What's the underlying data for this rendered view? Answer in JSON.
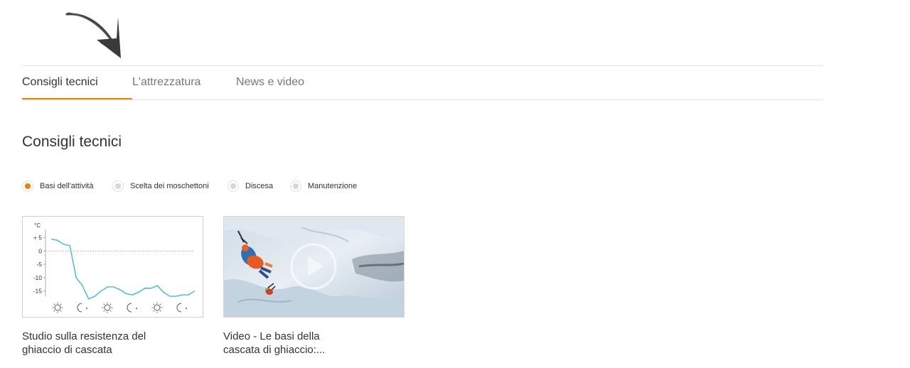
{
  "tabs": [
    {
      "label": "Consigli tecnici",
      "active": true
    },
    {
      "label": "L'attrezzatura",
      "active": false
    },
    {
      "label": "News e video",
      "active": false
    }
  ],
  "section": {
    "title": "Consigli tecnici"
  },
  "filters": [
    {
      "label": "Basi dell'attività",
      "selected": true
    },
    {
      "label": "Scelta dei moschettoni",
      "selected": false
    },
    {
      "label": "Discesa",
      "selected": false
    },
    {
      "label": "Manutenzione",
      "selected": false
    }
  ],
  "cards": [
    {
      "title_line1": "Studio sulla resistenza del",
      "title_line2": "ghiaccio di cascata",
      "thumb": "temperature-chart"
    },
    {
      "title_line1": "Video - Le basi della",
      "title_line2": "cascata di ghiaccio:...",
      "thumb": "ice-climbing-video"
    }
  ],
  "chart_data": {
    "type": "line",
    "title": "",
    "ylabel": "°C",
    "xlabel": "",
    "ylim": [
      -17,
      7
    ],
    "ytick_labels": [
      "+ 5",
      "0",
      "-5",
      "-10",
      "-15"
    ],
    "yticks": [
      5,
      0,
      -5,
      -10,
      -15
    ],
    "x_icons": [
      "sun-icon",
      "moon-icon",
      "sun-icon",
      "moon-icon",
      "sun-icon",
      "moon-icon"
    ],
    "series": [
      {
        "color": "#29b6e8",
        "values": [
          4.5,
          4,
          2.5,
          2,
          -10,
          -13,
          -18,
          -17,
          -15,
          -13.5,
          -13.5,
          -14.5,
          -16,
          -16.5,
          -15.5,
          -14,
          -14,
          -13,
          -15.5,
          -17,
          -17,
          -16.5,
          -16.5,
          -15
        ]
      }
    ],
    "zero_line": "dotted"
  },
  "colors": {
    "accent": "#f08200",
    "chart_line": "#29b6e8"
  }
}
